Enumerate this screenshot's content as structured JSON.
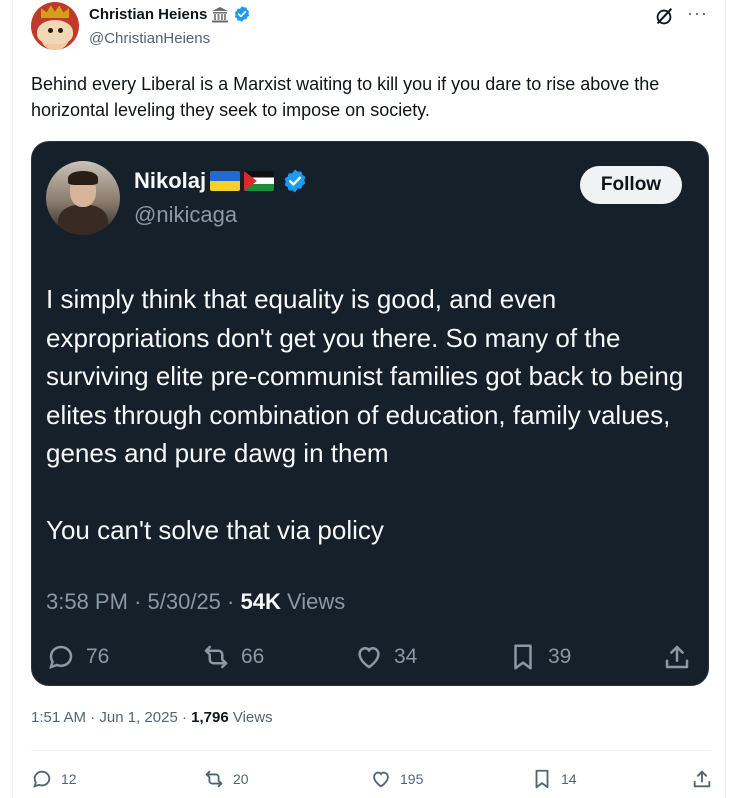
{
  "post": {
    "author": {
      "name": "Christian Heiens",
      "handle": "@ChristianHeiens"
    },
    "text": "Behind every Liberal is a Marxist waiting to kill you if you dare to rise above the horizontal leveling they seek to impose on society.",
    "time": "1:51 AM",
    "date": "Jun 1, 2025",
    "views_count": "1,796",
    "views_label": "Views",
    "stats": {
      "replies": "12",
      "reposts": "20",
      "likes": "195",
      "bookmarks": "14"
    }
  },
  "quoted": {
    "author": {
      "name": "Nikolaj",
      "handle": "@nikicaga"
    },
    "follow_label": "Follow",
    "text_paragraphs": [
      "I simply think that equality is good, and even expropriations don't get you there. So many of the surviving elite pre-communist families got back to being elites through combination of education, family values, genes and pure dawg in them",
      "You can't solve that via policy"
    ],
    "time": "3:58 PM",
    "date": "5/30/25",
    "views_count": "54K",
    "views_label": "Views",
    "stats": {
      "replies": "76",
      "reposts": "66",
      "likes": "34",
      "bookmarks": "39"
    }
  },
  "colors": {
    "verified": "#1d9bf0",
    "quote_bg": "#15202b",
    "muted": "#536471"
  },
  "icons": [
    "bank-icon",
    "verified-badge-icon",
    "grok-icon",
    "more-icon",
    "reply-icon",
    "repost-icon",
    "like-icon",
    "bookmark-icon",
    "share-icon"
  ]
}
